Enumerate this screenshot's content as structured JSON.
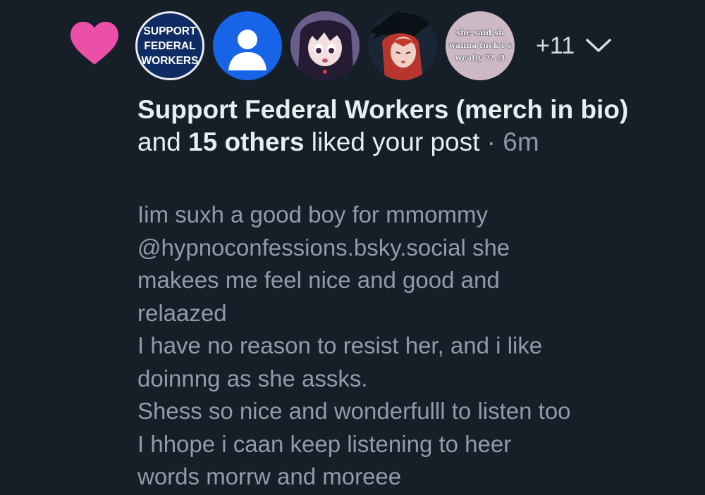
{
  "notification": {
    "icon": "heart-icon",
    "heart_color": "#ec4fa8",
    "avatars": [
      {
        "kind": "badge",
        "lines": [
          "SUPPORT",
          "FEDERAL",
          "WORKERS"
        ]
      },
      {
        "kind": "default-avatar",
        "icon": "person-icon"
      },
      {
        "kind": "anime-portrait"
      },
      {
        "kind": "anime-portrait-redhead"
      },
      {
        "kind": "text-meme",
        "lines": [
          "she said sh",
          "wanna fuck i s",
          "weally ?? :3"
        ]
      }
    ],
    "more_count": "+11",
    "expand_icon": "chevron-down-icon",
    "actor": "Support Federal Workers (merch in bio)",
    "conjunction": " and ",
    "others": "15 others",
    "action": " liked your post",
    "separator": " · ",
    "time": "6m"
  },
  "post": {
    "lines": [
      "Iim suxh a good boy for mmommy",
      "@hypnoconfessions.bsky.social she",
      "makees me feel nice and good and",
      "relaazed",
      "I have no reason to resist her, and i like",
      "doinnng as she assks.",
      "Shess so nice and wonderfulll to listen too",
      "I hhope i caan keep listening to heer",
      "words morrw and moreee"
    ]
  }
}
